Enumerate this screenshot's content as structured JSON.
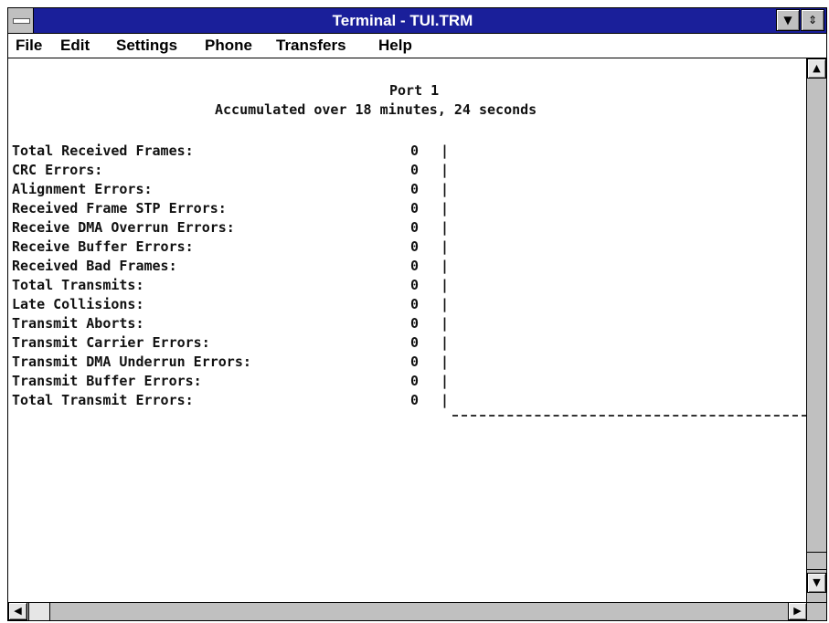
{
  "window": {
    "title": "Terminal - TUI.TRM",
    "minimize_glyph": "▼",
    "restore_glyph": "⇕"
  },
  "menu": [
    {
      "label": "File"
    },
    {
      "label": "Edit"
    },
    {
      "label": "Settings"
    },
    {
      "label": "Phone"
    },
    {
      "label": "Transfers"
    },
    {
      "label": "Help"
    }
  ],
  "terminal": {
    "port": "Port 1",
    "accumulated": "Accumulated over 18 minutes, 24 seconds",
    "separator": "|",
    "stats": [
      {
        "label": "Total Received Frames:",
        "value": "0"
      },
      {
        "label": "CRC Errors:",
        "value": "0"
      },
      {
        "label": "Alignment Errors:",
        "value": "0"
      },
      {
        "label": "Received Frame STP Errors:",
        "value": "0"
      },
      {
        "label": "Receive DMA Overrun Errors:",
        "value": "0"
      },
      {
        "label": "Receive Buffer Errors:",
        "value": "0"
      },
      {
        "label": "Received Bad Frames:",
        "value": "0"
      },
      {
        "label": "Total Transmits:",
        "value": "0"
      },
      {
        "label": "Late Collisions:",
        "value": "0"
      },
      {
        "label": "Transmit Aborts:",
        "value": "0"
      },
      {
        "label": "Transmit Carrier Errors:",
        "value": "0"
      },
      {
        "label": "Transmit DMA Underrun Errors:",
        "value": "0"
      },
      {
        "label": "Transmit Buffer Errors:",
        "value": "0"
      },
      {
        "label": "Total Transmit Errors:",
        "value": "0"
      }
    ]
  },
  "scrollbars": {
    "up_glyph": "▲",
    "down_glyph": "▼",
    "left_glyph": "◀",
    "right_glyph": "▶"
  }
}
